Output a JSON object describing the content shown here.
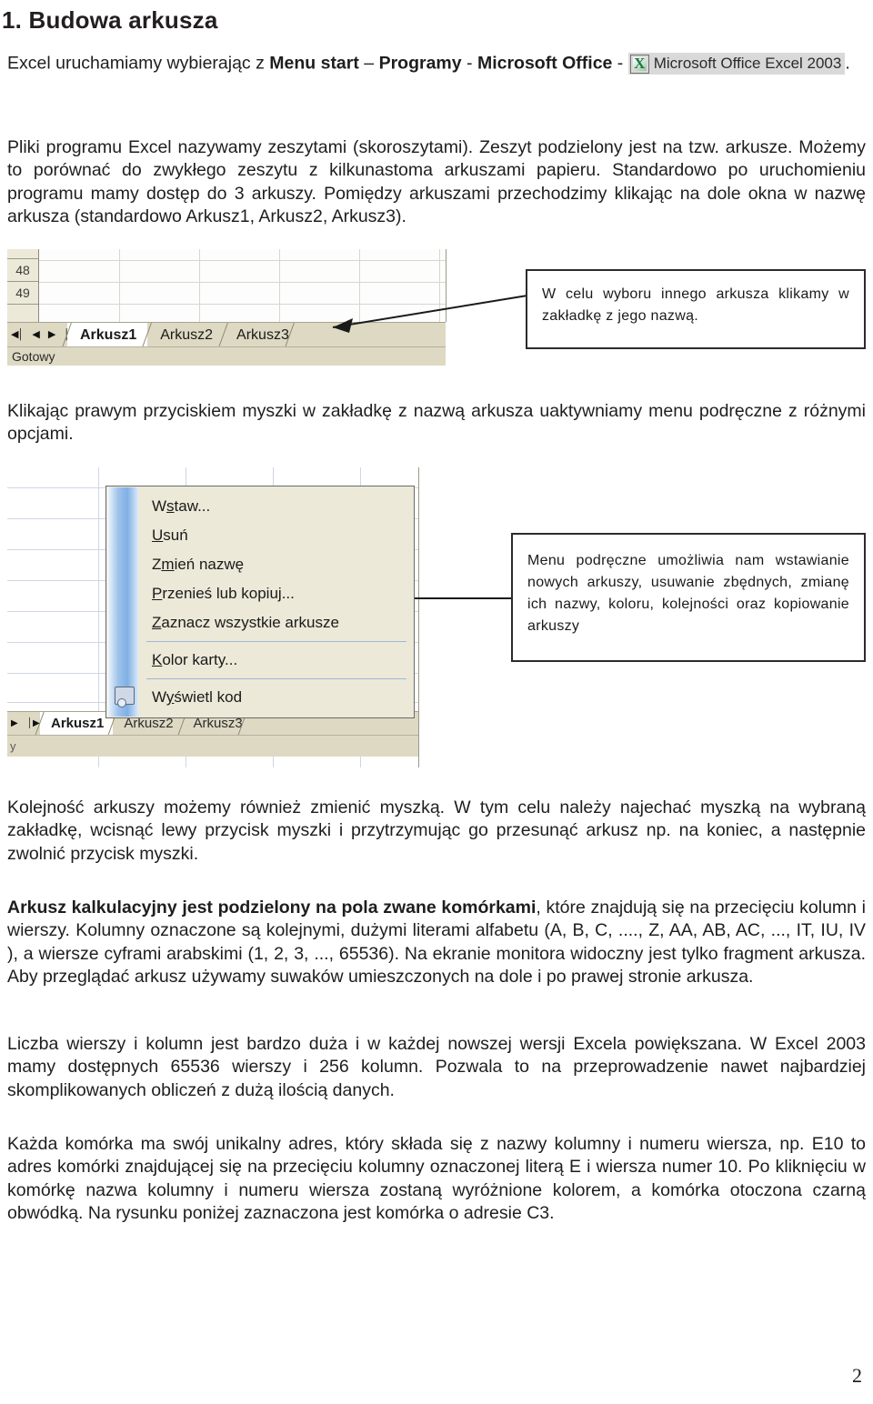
{
  "document": {
    "heading": "1. Budowa arkusza",
    "page_number": "2"
  },
  "intro": {
    "text_before": "Excel uruchamiamy wybierając z ",
    "bold_1": "Menu start",
    "dash_1": " – ",
    "bold_2": "Programy",
    "dash_2": " - ",
    "bold_3": "Microsoft Office",
    "dash_3": " - ",
    "excel_chip_label": "Microsoft Office Excel 2003",
    "trailing_period": "."
  },
  "paragraphs": {
    "p2": "Pliki programu Excel nazywamy zeszytami (skoroszytami). Zeszyt podzielony jest na tzw. arkusze. Możemy to porównać do zwykłego zeszytu z kilkunastoma arkuszami papieru. Standardowo po uruchomieniu programu mamy dostęp do 3 arkuszy. Pomiędzy arkuszami przechodzimy klikając na dole okna w nazwę arkusza (standardowo Arkusz1, Arkusz2, Arkusz3).",
    "p3": "Klikając prawym przyciskiem myszki w zakładkę z nazwą arkusza uaktywniamy menu podręczne z różnymi opcjami.",
    "p4": "Kolejność arkuszy możemy również zmienić myszką. W tym celu należy najechać myszką na wybraną zakładkę, wcisnąć lewy przycisk myszki i przytrzymując go przesunąć arkusz  np. na koniec,  a następnie  zwolnić przycisk myszki.",
    "p5_bold": "Arkusz kalkulacyjny jest podzielony na pola zwane komórkami",
    "p5_rest": ", które  znajdują się na przecięciu kolumn i wierszy. Kolumny oznaczone są  kolejnymi, dużymi literami alfabetu (A, B, C, ...., Z, AA, AB, AC, ..., IT, IU, IV ), a wiersze cyframi arabskimi (1, 2, 3, ..., 65536).  Na ekranie monitora widoczny jest tylko fragment arkusza. Aby przeglądać arkusz używamy suwaków umieszczonych  na dole i po prawej stronie arkusza.",
    "p6": "Liczba wierszy i kolumn jest bardzo duża i w każdej nowszej wersji Excela powiększana. W Excel 2003 mamy dostępnych 65536 wierszy i 256 kolumn.  Pozwala to na przeprowadzenie nawet najbardziej skomplikowanych obliczeń z dużą ilością danych.",
    "p7": "Każda komórka ma swój unikalny adres, który składa się z nazwy kolumny i numeru wiersza, np. E10 to adres komórki znajdującej się na przecięciu kolumny oznaczonej literą E i wiersza numer 10. Po kliknięciu w komórkę nazwa kolumny i numeru wiersza zostaną wyróżnione kolorem, a komórka otoczona czarną obwódką. Na rysunku poniżej zaznaczona jest komórka o adresie C3."
  },
  "figure1": {
    "row_headers": [
      "48",
      "49"
    ],
    "tabs": [
      {
        "label": "Arkusz1",
        "active": true
      },
      {
        "label": "Arkusz2",
        "active": false
      },
      {
        "label": "Arkusz3",
        "active": false
      }
    ],
    "nav_buttons": [
      "first-sheet",
      "previous-sheet",
      "next-sheet",
      "last-sheet"
    ],
    "nav_glyphs": [
      "◀│",
      "◀",
      "▶",
      "│▶"
    ],
    "status_text": "Gotowy",
    "callout": "W celu wyboru innego arkusza klikamy w zakładkę z jego nazwą."
  },
  "figure2": {
    "menu_items": [
      {
        "pre": "W",
        "mnemonic": "s",
        "post": "taw..."
      },
      {
        "pre": "",
        "mnemonic": "U",
        "post": "suń"
      },
      {
        "pre": "Z",
        "mnemonic": "m",
        "post": "ień nazwę"
      },
      {
        "pre": "",
        "mnemonic": "P",
        "post": "rzenieś lub kopiuj..."
      },
      {
        "pre": "",
        "mnemonic": "Z",
        "post": "aznacz wszystkie arkusze"
      },
      {
        "pre": "",
        "mnemonic": "K",
        "post": "olor karty..."
      },
      {
        "pre": "W",
        "mnemonic": "y",
        "post": "świetl kod"
      }
    ],
    "tabs": [
      {
        "label": "Arkusz1",
        "active": true
      },
      {
        "label": "Arkusz2",
        "active": false
      },
      {
        "label": "Arkusz3",
        "active": false
      }
    ],
    "nav_glyphs": [
      "▶",
      "│▶"
    ],
    "status_text": "y",
    "callout": "Menu podręczne umożliwia nam wstawianie nowych arkuszy, usuwanie zbędnych, zmianę ich nazwy, koloru, kolejności oraz kopiowanie arkuszy"
  },
  "colors": {
    "excel_tabbar": "#ddd9c3",
    "excel_green": "#1c7a3e",
    "menu_gutter_blue": "#7fb0e4",
    "text": "#1a1a1a"
  }
}
